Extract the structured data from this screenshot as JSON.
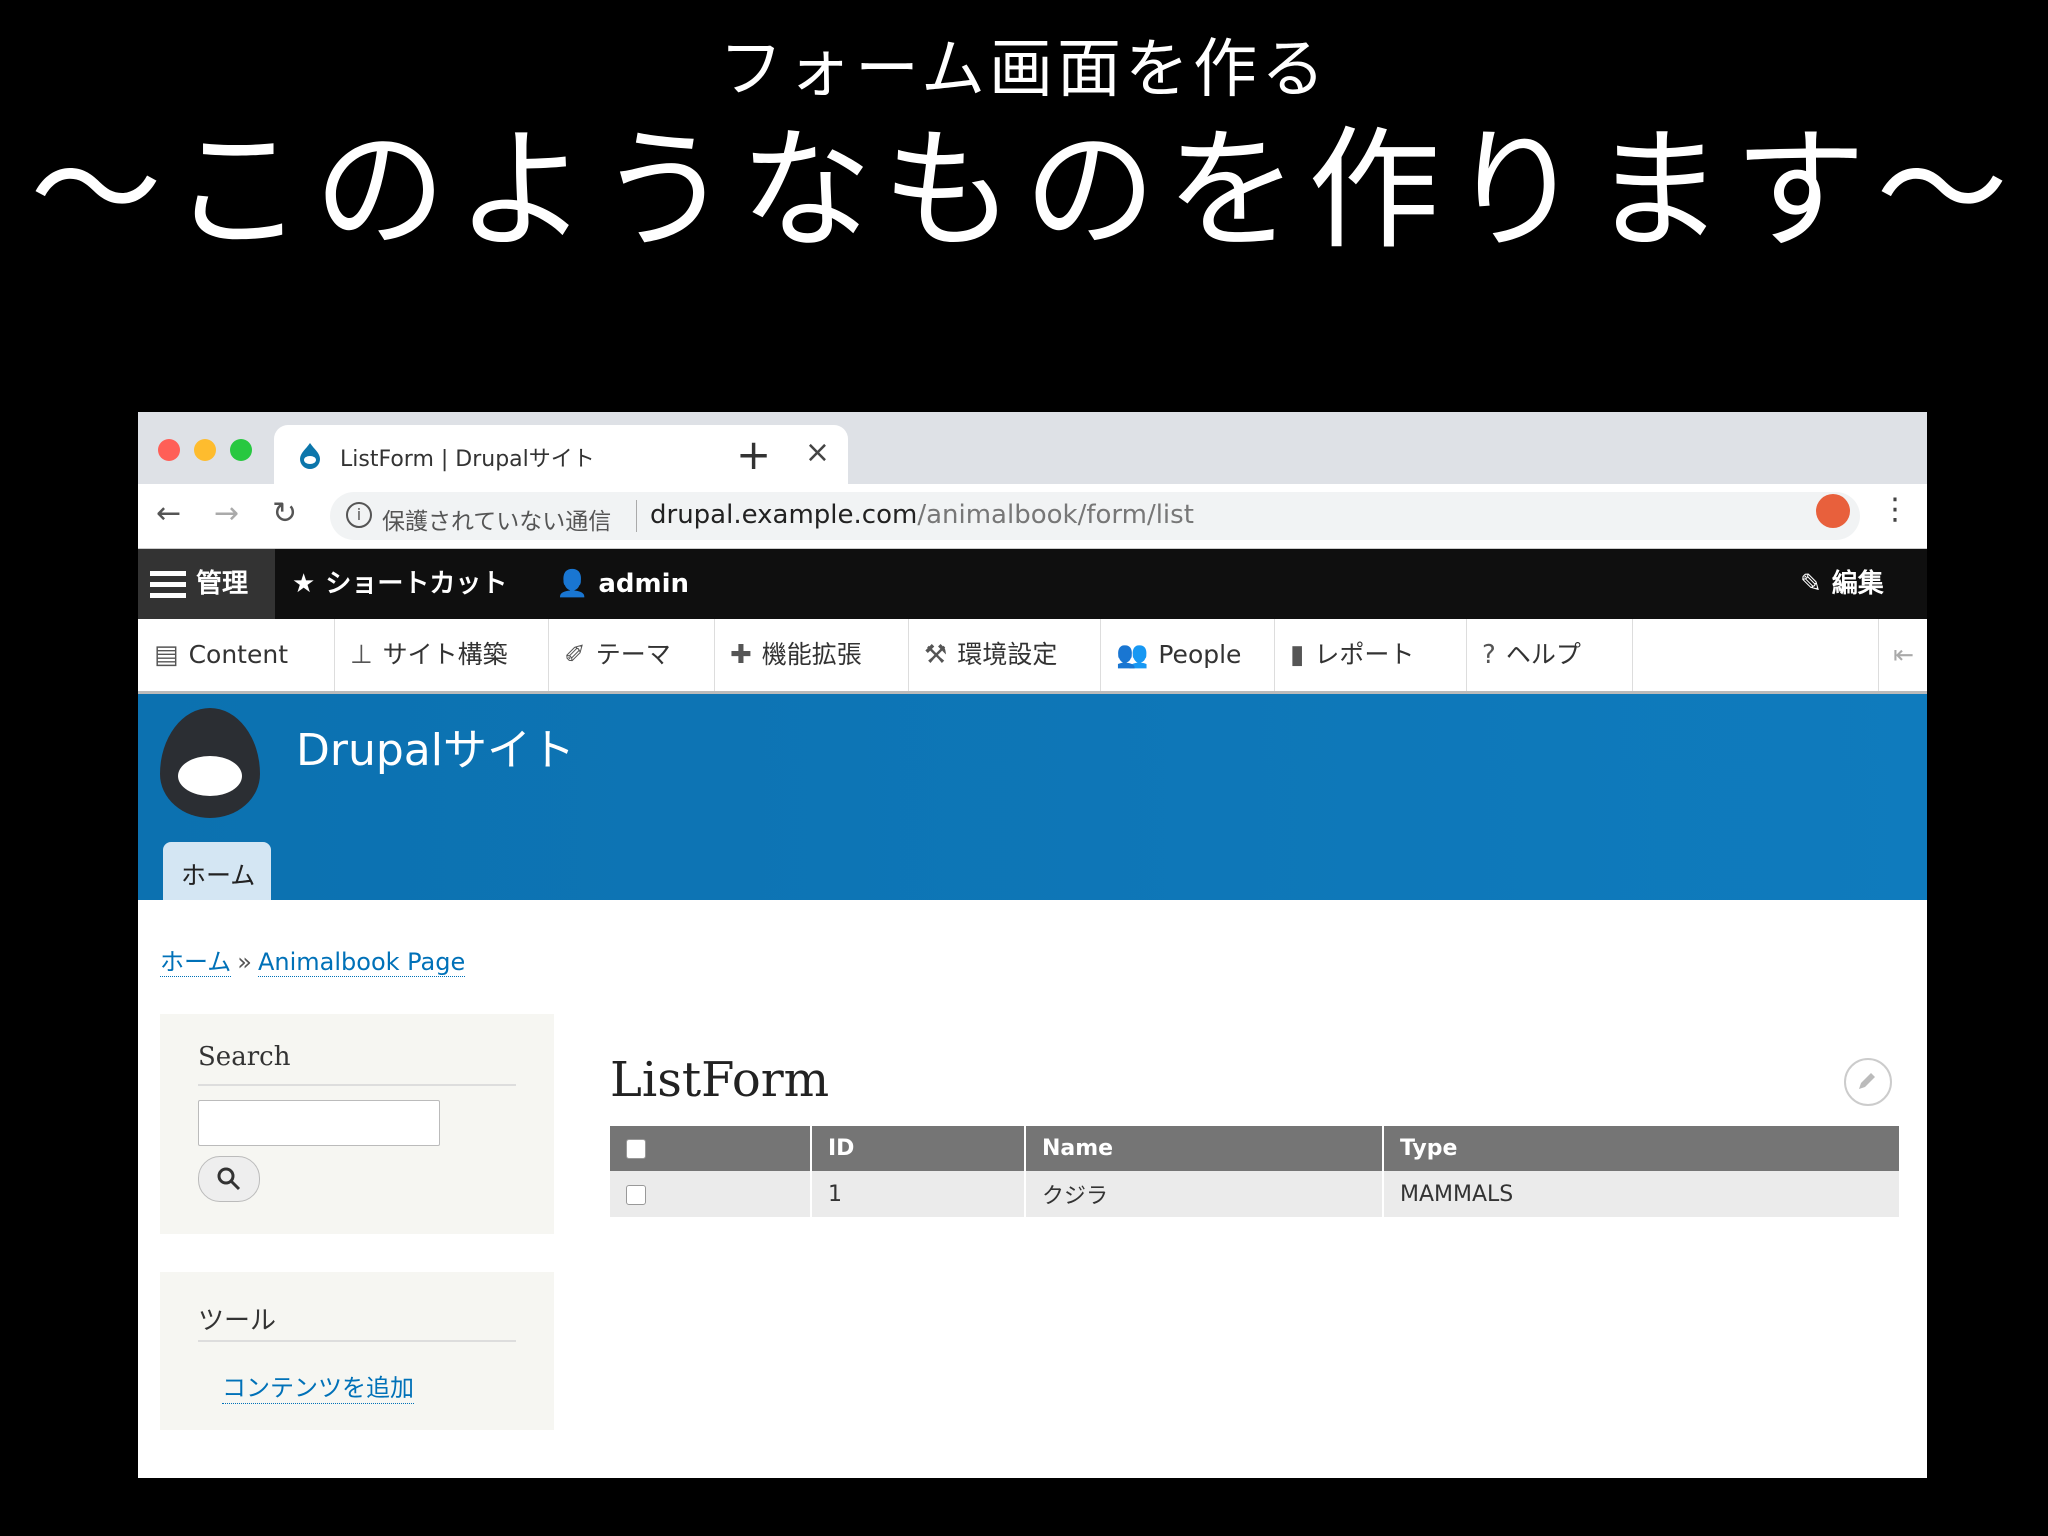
{
  "slide": {
    "subtitle": "フォーム画面を作る",
    "title": "〜このようなものを作ります〜"
  },
  "browser": {
    "tab_title": "ListForm | Drupalサイト",
    "security_label": "保護されていない通信",
    "url_host": "drupal.example.com",
    "url_path": "/animalbook/form/list"
  },
  "admin_toolbar": {
    "manage": "管理",
    "shortcuts": "ショートカット",
    "user": "admin",
    "edit": "編集"
  },
  "admin_tray": [
    {
      "label": "Content",
      "icon": "file-icon"
    },
    {
      "label": "サイト構築",
      "icon": "sitemap-icon"
    },
    {
      "label": "テーマ",
      "icon": "brush-icon"
    },
    {
      "label": "機能拡張",
      "icon": "puzzle-icon"
    },
    {
      "label": "環境設定",
      "icon": "wrench-icon"
    },
    {
      "label": "People",
      "icon": "people-icon"
    },
    {
      "label": "レポート",
      "icon": "bar-chart-icon"
    },
    {
      "label": "ヘルプ",
      "icon": "help-icon"
    }
  ],
  "site": {
    "name": "Drupalサイト",
    "home_tab": "ホーム"
  },
  "breadcrumb": {
    "home": "ホーム",
    "separator": "»",
    "current": "Animalbook Page"
  },
  "search_block": {
    "title": "Search"
  },
  "tools_block": {
    "title": "ツール",
    "link": "コンテンツを追加"
  },
  "page": {
    "title": "ListForm"
  },
  "table": {
    "headers": [
      "ID",
      "Name",
      "Type"
    ],
    "rows": [
      {
        "id": "1",
        "name": "クジラ",
        "type": "MAMMALS"
      }
    ]
  },
  "colors": {
    "header_blue": "#0c71b0",
    "link_blue": "#0071b8",
    "table_header": "#757575"
  }
}
